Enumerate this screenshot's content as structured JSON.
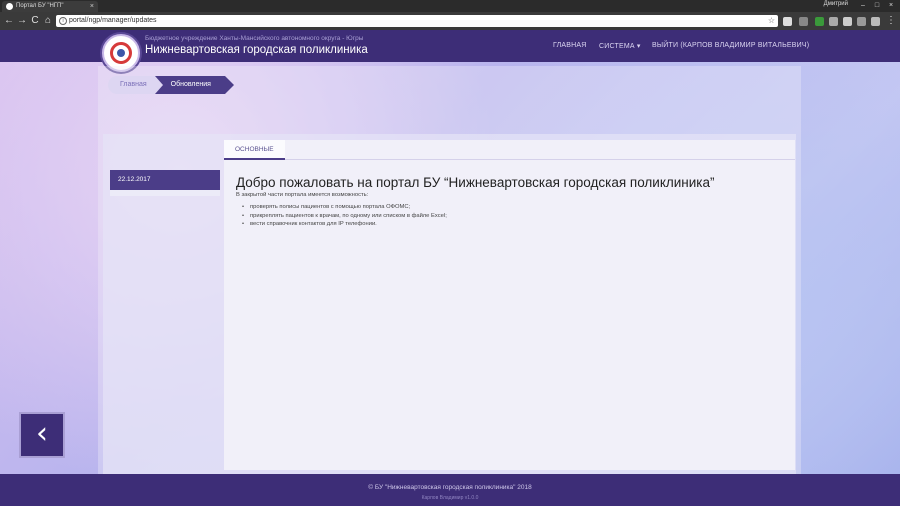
{
  "browser": {
    "tab_title": "Портал БУ \"НГП\"",
    "tab_close": "×",
    "profile_name": "Дмитрий",
    "url": "portal/ngp/manager/updates",
    "back": "←",
    "forward": "→",
    "reload": "C",
    "home": "⌂",
    "info": "i",
    "star": "☆",
    "minimize": "–",
    "maximize": "□",
    "close": "×",
    "menu": "⋮"
  },
  "header": {
    "subtitle": "Бюджетное учреждение Ханты-Мансийского автономного округа - Югры",
    "title": "Нижневартовская городская поликлиника",
    "nav": {
      "home": "ГЛАВНАЯ",
      "system": "СИСТЕМА ▾",
      "logout": "ВЫЙТИ (КАРПОВ ВЛАДИМИР ВИТАЛЬЕВИЧ)"
    }
  },
  "breadcrumb": {
    "home": "Главная",
    "current": "Обновления"
  },
  "sidebar": {
    "items": [
      "22.12.2017"
    ]
  },
  "content": {
    "tab": "ОСНОВНЫЕ",
    "heading": "Добро пожаловать на портал БУ “Нижневартовская городская поликлиника”",
    "intro": "В закрытой части портала имеется возможность:",
    "features": [
      "проверять полисы пациентов с помощью портала ОФОМС;",
      "прикреплять пациентов к врачам, по одному или списком в файле Excel;",
      "вести справочник контактов для IP телефонии."
    ]
  },
  "back_button": "‹",
  "footer": {
    "copyright": "© БУ \"Нижневартовская городская поликлиника\" 2018",
    "user": "Карпов Владимир    v1.0.0"
  }
}
